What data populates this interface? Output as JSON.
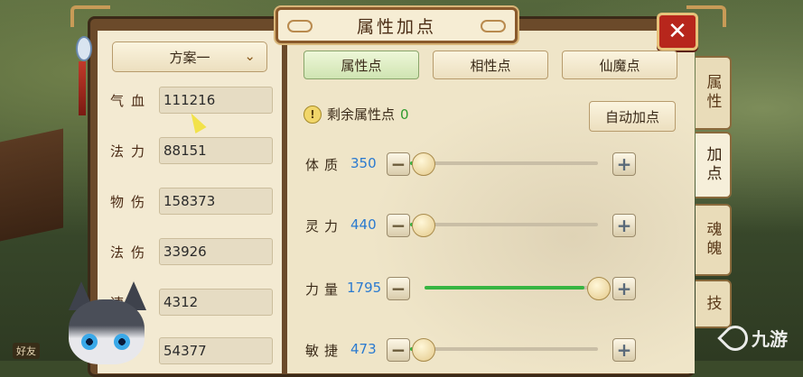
{
  "window": {
    "title": "属性加点",
    "close_label": "✕"
  },
  "side_tabs": [
    {
      "label": "属性",
      "active": false
    },
    {
      "label": "加点",
      "active": true
    },
    {
      "label": "魂魄",
      "active": false
    },
    {
      "label": "技",
      "active": false
    }
  ],
  "plan": {
    "selected": "方案一"
  },
  "stats": [
    {
      "label": "气血",
      "value": "111216"
    },
    {
      "label": "法力",
      "value": "88151"
    },
    {
      "label": "物伤",
      "value": "158373"
    },
    {
      "label": "法伤",
      "value": "33926"
    },
    {
      "label": "速",
      "value": "4312"
    },
    {
      "label": "",
      "value": "54377"
    }
  ],
  "top_tabs": [
    {
      "label": "属性点",
      "active": true
    },
    {
      "label": "相性点",
      "active": false
    },
    {
      "label": "仙魔点",
      "active": false
    }
  ],
  "remaining": {
    "label": "剩余属性点",
    "value": "0"
  },
  "auto_button": "自动加点",
  "attributes": [
    {
      "label": "体质",
      "value": "350",
      "fill_fraction": 0.02
    },
    {
      "label": "灵力",
      "value": "440",
      "fill_fraction": 0.02
    },
    {
      "label": "力量",
      "value": "1795",
      "fill_fraction": 0.92
    },
    {
      "label": "敏捷",
      "value": "473",
      "fill_fraction": 0.02
    }
  ],
  "friends_label": "好友",
  "watermark": "九游",
  "colors": {
    "accent_green": "#36b542",
    "value_blue": "#2a7ad0",
    "close_red": "#b7261c"
  }
}
